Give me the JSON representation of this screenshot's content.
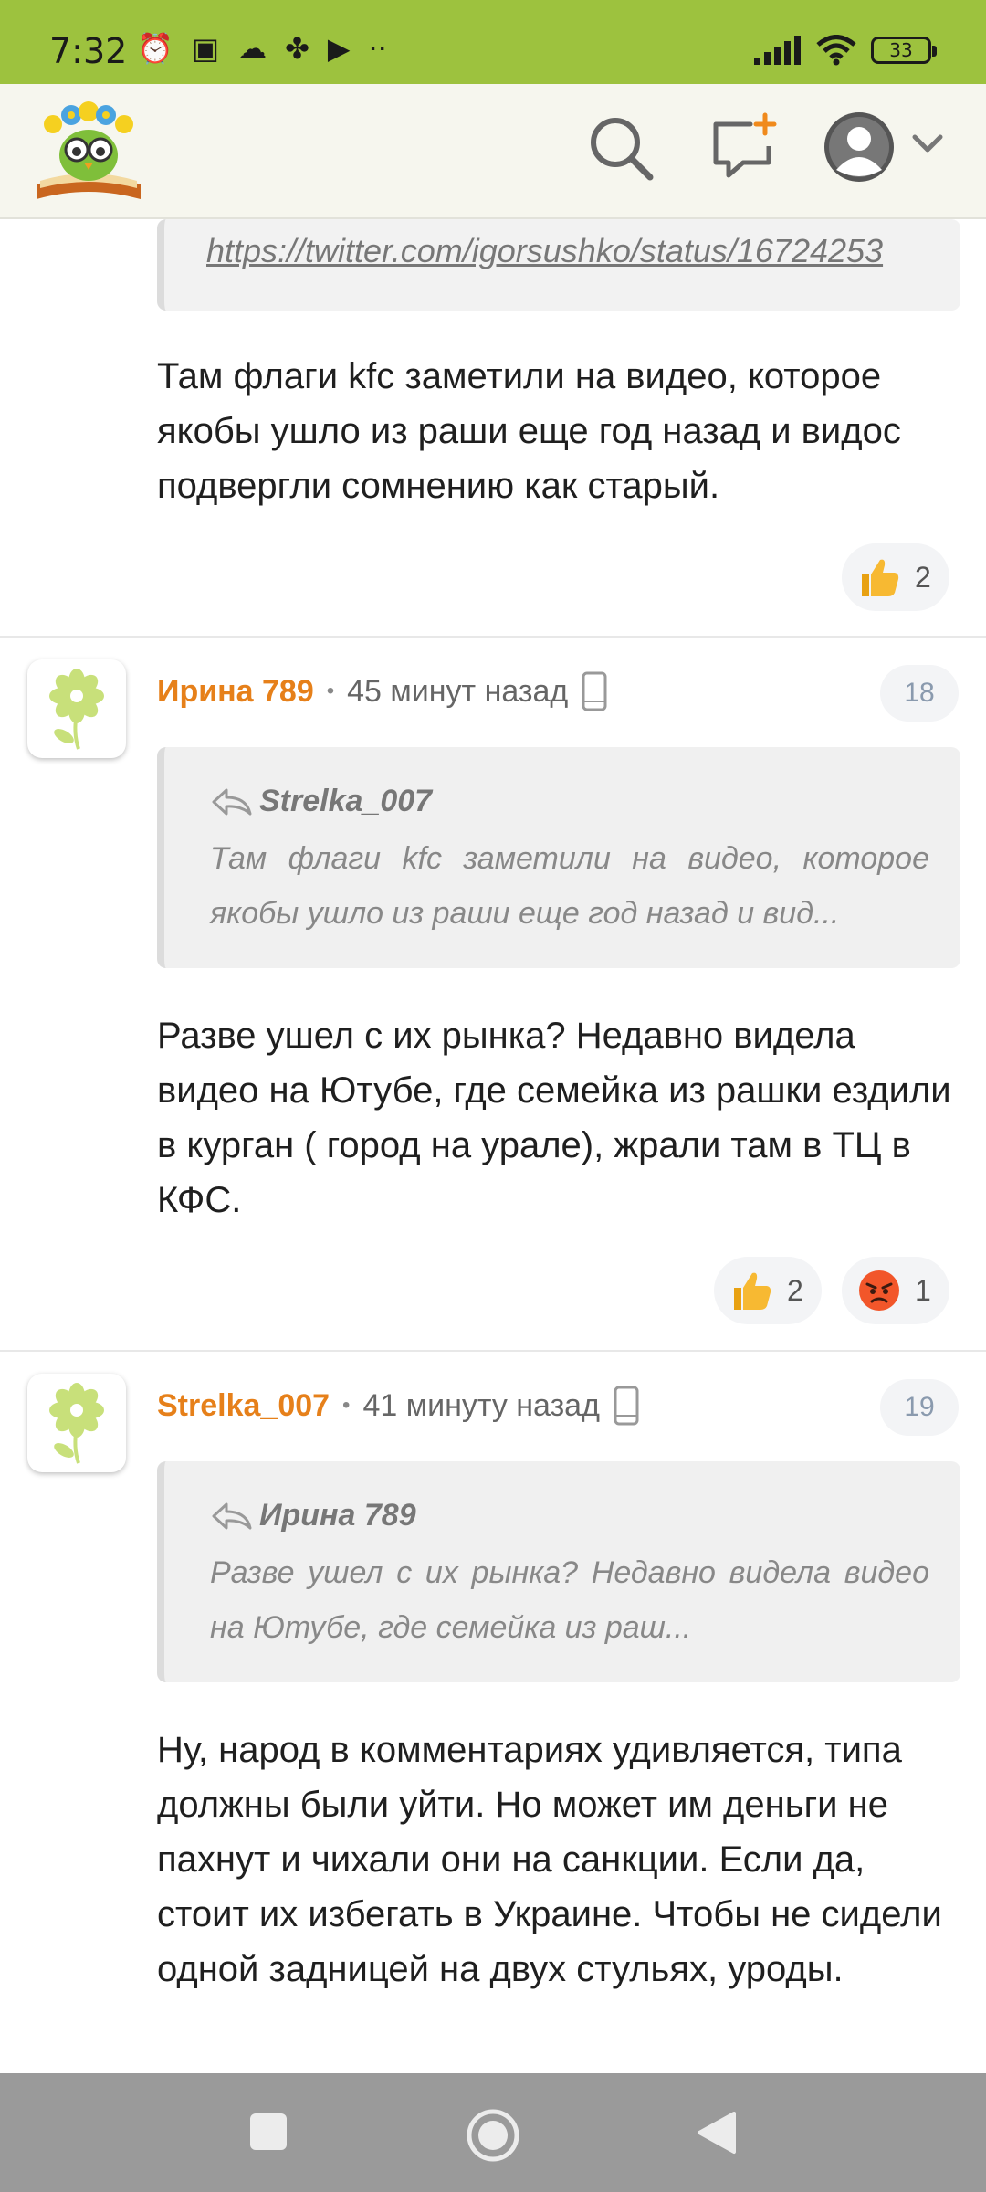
{
  "status_bar": {
    "time": "7:32",
    "left_icons": [
      "alarm-icon",
      "nfc-icon",
      "cloud-icon",
      "app-icon",
      "play-icon",
      "more-icon"
    ],
    "battery": "33"
  },
  "header": {
    "logo": "owl-on-book-logo",
    "icons": [
      "search-icon",
      "compose-icon",
      "account-icon",
      "chevron-down-icon"
    ]
  },
  "top_comment": {
    "link": "https://twitter.com/igorsushko/status/16724253",
    "text": "Там флаги kfc заметили на видео, которое якобы ушло из раши еще год назад и видос подвергли сомнению как старый.",
    "reactions": [
      {
        "emoji": "thumbs-up",
        "count": "2"
      }
    ]
  },
  "comments": [
    {
      "author": "Ирина 789",
      "dot": "•",
      "time": "45 минут назад",
      "number": "18",
      "quote_author": "Strelka_007",
      "quote_text": "Там флаги kfc заметили на видео, которое якобы ушло из раши еще год назад и вид...",
      "text": "Разве ушел с их рынка? Недавно видела видео на Ютубе, где семейка из рашки ездили в курган ( город на урале), жрали там в ТЦ в КФС.",
      "reactions": [
        {
          "emoji": "thumbs-up",
          "count": "2"
        },
        {
          "emoji": "angry-face",
          "count": "1"
        }
      ]
    },
    {
      "author": "Strelka_007",
      "dot": "•",
      "time": "41 минуту назад",
      "number": "19",
      "quote_author": "Ирина 789",
      "quote_text": "Разве ушел с их рынка? Недавно видела видео на Ютубе, где семейка из раш...",
      "text": "Ну, народ в комментариях удивляется, типа должны были уйти. Но может им деньги не пахнут и чихали они на санкции. Если да, стоит их избегать в Украине. Чтобы не сидели одной задницей на двух стульях, уроды.",
      "reactions": []
    }
  ],
  "colors": {
    "status_bar": "#9dc23e",
    "author": "#e6801a",
    "nav_bar": "#9a9a9a"
  }
}
